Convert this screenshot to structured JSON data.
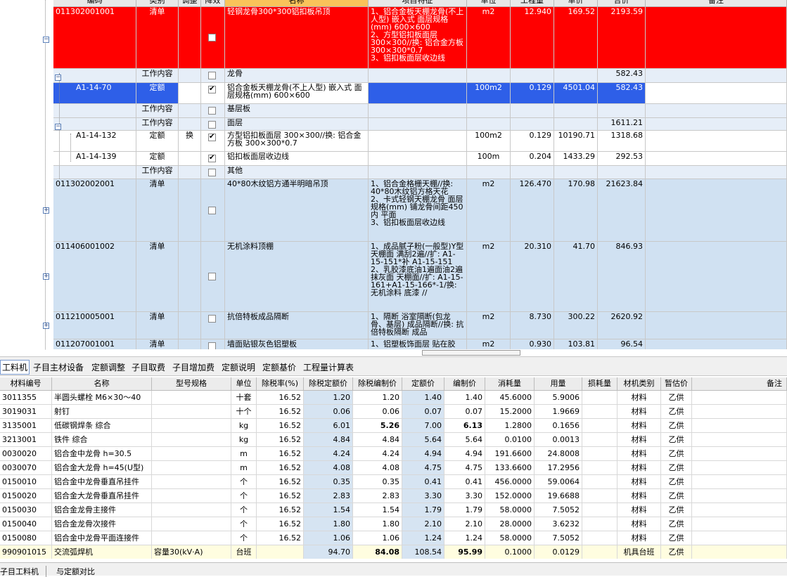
{
  "top_headers": [
    "编码",
    "类别",
    "调整",
    "降效",
    "名称",
    "项目特征",
    "单位",
    "工程量",
    "单价",
    "合价",
    "备注"
  ],
  "top_rows": [
    {
      "code": "011302001001",
      "type": "清单",
      "adj": "",
      "name": "轻钢龙骨300*300铝扣板吊顶",
      "feature": "1、铝合金板天棚龙骨(不上人型) 嵌入式 面层规格(mm) 600×600\n2、方型铝扣板面层 300×300//换: 铝合金方板 300×300*0.7\n3、铝扣板面层收边线",
      "unit": "m2",
      "qty": "12.940",
      "price": "169.52",
      "total": "2193.59",
      "checked": false
    },
    {
      "code": "",
      "type": "工作内容",
      "adj": "",
      "name": "龙骨",
      "feature": "",
      "unit": "",
      "qty": "",
      "price": "",
      "total": "582.43",
      "checked": false
    },
    {
      "code": "A1-14-70",
      "type": "定额",
      "adj": "",
      "name": "铝合金板天棚龙骨(不上人型) 嵌入式 面层规格(mm) 600×600",
      "feature": "",
      "unit": "100m2",
      "qty": "0.129",
      "price": "4501.04",
      "total": "582.43",
      "checked": true
    },
    {
      "code": "",
      "type": "工作内容",
      "adj": "",
      "name": "基层板",
      "feature": "",
      "unit": "",
      "qty": "",
      "price": "",
      "total": "",
      "checked": false
    },
    {
      "code": "",
      "type": "工作内容",
      "adj": "",
      "name": "面层",
      "feature": "",
      "unit": "",
      "qty": "",
      "price": "",
      "total": "1611.21",
      "checked": false
    },
    {
      "code": "A1-14-132",
      "type": "定额",
      "adj": "换",
      "name": "方型铝扣板面层 300×300//换: 铝合金方板 300×300*0.7",
      "feature": "",
      "unit": "100m2",
      "qty": "0.129",
      "price": "10190.71",
      "total": "1318.68",
      "checked": true
    },
    {
      "code": "A1-14-139",
      "type": "定额",
      "adj": "",
      "name": "铝扣板面层收边线",
      "feature": "",
      "unit": "100m",
      "qty": "0.204",
      "price": "1433.29",
      "total": "292.53",
      "checked": true
    },
    {
      "code": "",
      "type": "工作内容",
      "adj": "",
      "name": "其他",
      "feature": "",
      "unit": "",
      "qty": "",
      "price": "",
      "total": "",
      "checked": false
    },
    {
      "code": "011302002001",
      "type": "清单",
      "adj": "",
      "name": "40*80木纹铝方通半明暗吊顶",
      "feature": "1、铝合金格栅天棚//换: 40*80木纹铝方格天花\n2、卡式轻钢天棚龙骨 面层规格(mm) 铺龙骨间距450内 平面\n3、铝扣板面层收边线",
      "unit": "m2",
      "qty": "126.470",
      "price": "170.98",
      "total": "21623.84",
      "checked": false
    },
    {
      "code": "011406001002",
      "type": "清单",
      "adj": "",
      "name": "无机涂料顶棚",
      "feature": "1、成品腻子粉(一般型)Y型 天棚面 满刮2遍//扩: A1-15-151*补 A1-15-151\n2、乳胶漆底油1遍面油2遍 抹灰面 天棚面//扩: A1-15-161+A1-15-166*-1/换: 无机涂料 底漆 //",
      "unit": "m2",
      "qty": "20.310",
      "price": "41.70",
      "total": "846.93",
      "checked": false
    },
    {
      "code": "011210005001",
      "type": "清单",
      "adj": "",
      "name": "抗倍特板成品隔断",
      "feature": "1、隔断 浴室隔断(包龙骨、基层) 成品隔断//换: 抗倍特板隔断 成品",
      "unit": "m2",
      "qty": "8.730",
      "price": "300.22",
      "total": "2620.92",
      "checked": false
    },
    {
      "code": "011207001001",
      "type": "清单",
      "adj": "",
      "name": "墙面贴银灰色铝塑板",
      "feature": "1、铝塑板饰面层 贴在胶",
      "unit": "m2",
      "qty": "0.930",
      "price": "103.81",
      "total": "96.54",
      "checked": false
    }
  ],
  "tabs": [
    "工料机",
    "子目主材设备",
    "定额调整",
    "子目取费",
    "子目增加费",
    "定额说明",
    "定额基价",
    "工程量计算表"
  ],
  "bottom_headers": [
    "材料编号",
    "名称",
    "型号规格",
    "单位",
    "除税率(%)",
    "除税定额价",
    "除税编制价",
    "定额价",
    "编制价",
    "消耗量",
    "用量",
    "损耗量",
    "材机类别",
    "暂估价",
    "备注"
  ],
  "bottom_rows": [
    [
      "3011355",
      "半圆头螺栓 M6×30～40",
      "",
      "十套",
      "16.52",
      "1.20",
      "1.20",
      "1.40",
      "1.40",
      "45.6000",
      "5.9006",
      "",
      "材料",
      "乙供",
      ""
    ],
    [
      "3019031",
      "射钉",
      "",
      "十个",
      "16.52",
      "0.06",
      "0.06",
      "0.07",
      "0.07",
      "15.2000",
      "1.9669",
      "",
      "材料",
      "乙供",
      ""
    ],
    [
      "3135001",
      "低碳钢焊条 综合",
      "",
      "kg",
      "16.52",
      "6.01",
      "5.26",
      "7.00",
      "6.13",
      "1.2800",
      "0.1656",
      "",
      "材料",
      "乙供",
      ""
    ],
    [
      "3213001",
      "铁件 综合",
      "",
      "kg",
      "16.52",
      "4.84",
      "4.84",
      "5.64",
      "5.64",
      "0.0100",
      "0.0013",
      "",
      "材料",
      "乙供",
      ""
    ],
    [
      "0030020",
      "铝合金中龙骨 h=30.5",
      "",
      "m",
      "16.52",
      "4.24",
      "4.24",
      "4.94",
      "4.94",
      "191.6600",
      "24.8008",
      "",
      "材料",
      "乙供",
      ""
    ],
    [
      "0030070",
      "铝合金大龙骨 h=45(U型)",
      "",
      "m",
      "16.52",
      "4.08",
      "4.08",
      "4.75",
      "4.75",
      "133.6600",
      "17.2956",
      "",
      "材料",
      "乙供",
      ""
    ],
    [
      "0150010",
      "铝合金中龙骨垂直吊挂件",
      "",
      "个",
      "16.52",
      "0.35",
      "0.35",
      "0.41",
      "0.41",
      "456.0000",
      "59.0064",
      "",
      "材料",
      "乙供",
      ""
    ],
    [
      "0150020",
      "铝合金大龙骨垂直吊挂件",
      "",
      "个",
      "16.52",
      "2.83",
      "2.83",
      "3.30",
      "3.30",
      "152.0000",
      "19.6688",
      "",
      "材料",
      "乙供",
      ""
    ],
    [
      "0150030",
      "铝合金龙骨主接件",
      "",
      "个",
      "16.52",
      "1.54",
      "1.54",
      "1.79",
      "1.79",
      "58.0000",
      "7.5052",
      "",
      "材料",
      "乙供",
      ""
    ],
    [
      "0150040",
      "铝合金龙骨次接件",
      "",
      "个",
      "16.52",
      "1.80",
      "1.80",
      "2.10",
      "2.10",
      "28.0000",
      "3.6232",
      "",
      "材料",
      "乙供",
      ""
    ],
    [
      "0150080",
      "铝合金中龙骨平面连接件",
      "",
      "个",
      "16.52",
      "1.06",
      "1.06",
      "1.24",
      "1.24",
      "58.0000",
      "7.5052",
      "",
      "材料",
      "乙供",
      ""
    ],
    [
      "990901015",
      "交流弧焊机",
      "容量30(kV·A)",
      "台班",
      "",
      "94.70",
      "84.08",
      "108.54",
      "95.99",
      "0.1000",
      "0.0129",
      "",
      "机具台班",
      "乙供",
      ""
    ]
  ],
  "bottom_tabs": [
    "子目工料机",
    "与定额对比"
  ],
  "colors": {
    "red": "#ff0000",
    "selected": "#2e5fe8",
    "light_blue": "#d0e1f2",
    "header_orange": "#f9c35a",
    "machine_row": "#fffde0"
  }
}
